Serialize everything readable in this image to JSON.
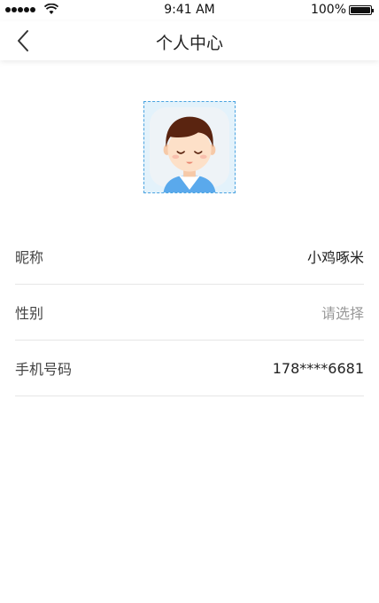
{
  "status_bar": {
    "time": "9:41 AM",
    "battery_percent": "100%"
  },
  "nav": {
    "title": "个人中心",
    "back_icon": "chevron-left-icon"
  },
  "avatar": {
    "icon": "user-avatar-icon",
    "colors": {
      "background": "#e3f2fb",
      "border": "#4aa3e0",
      "hair": "#5a2410",
      "skin": "#fde0c8",
      "shirt": "#5aa9ec"
    }
  },
  "profile": {
    "nickname": {
      "label": "昵称",
      "value": "小鸡啄米"
    },
    "gender": {
      "label": "性别",
      "placeholder": "请选择"
    },
    "phone": {
      "label": "手机号码",
      "value": "178****6681"
    }
  }
}
